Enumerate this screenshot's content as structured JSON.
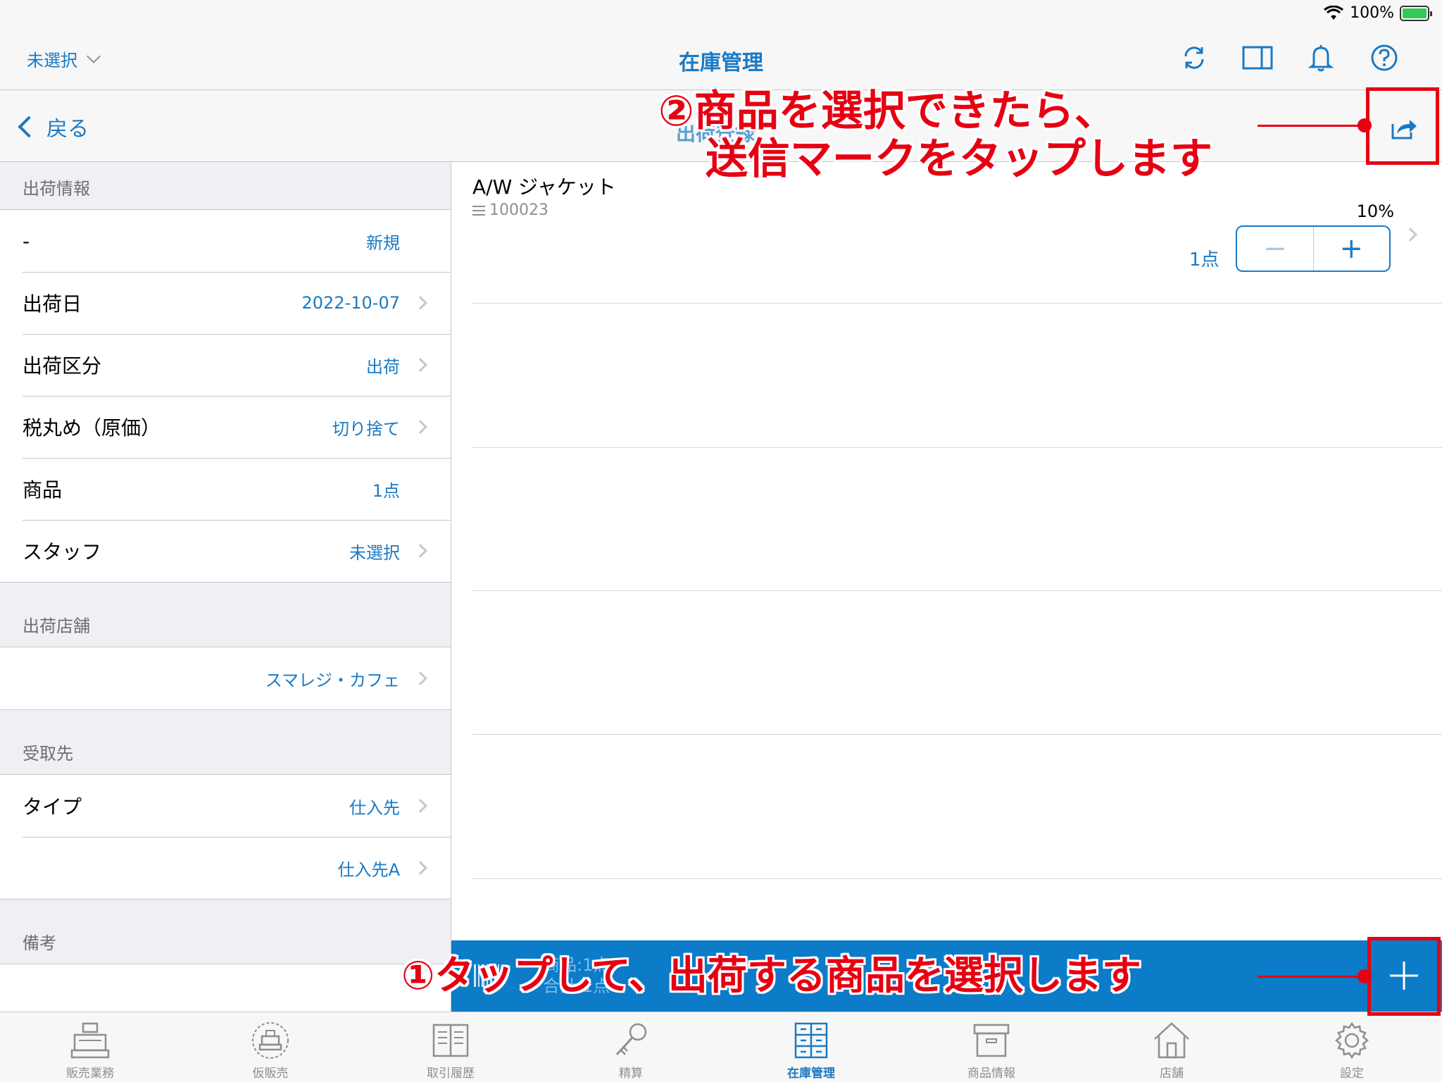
{
  "status": {
    "battery": "100%",
    "battery_level": 1.0
  },
  "nav": {
    "left_label": "未選択",
    "title": "在庫管理",
    "icons": [
      "refresh-icon",
      "split-view-icon",
      "bell-icon",
      "help-icon"
    ]
  },
  "subheader": {
    "back_label": "戻る",
    "title": "出荷登録"
  },
  "sections": {
    "shipping_info": {
      "header": "出荷情報",
      "rows": [
        {
          "label": "-",
          "value": "新規"
        },
        {
          "label": "出荷日",
          "value": "2022-10-07"
        },
        {
          "label": "出荷区分",
          "value": "出荷"
        },
        {
          "label": "税丸め（原価）",
          "value": "切り捨て"
        },
        {
          "label": "商品",
          "value": "1点"
        },
        {
          "label": "スタッフ",
          "value": "未選択"
        }
      ]
    },
    "store": {
      "header": "出荷店舗",
      "value": "スマレジ・カフェ"
    },
    "recipient": {
      "header": "受取先",
      "rows": [
        {
          "label": "タイプ",
          "value": "仕入先"
        },
        {
          "label": "",
          "value": "仕入先A"
        }
      ]
    },
    "notes": {
      "header": "備考"
    }
  },
  "product": {
    "name": "A/W ジャケット",
    "code": "100023",
    "tax": "10%",
    "qty": "1点",
    "minus": "−",
    "plus": "+"
  },
  "summary": {
    "line1": "商品:1点",
    "line2": "合計:1点"
  },
  "tabs": [
    {
      "label": "販売業務",
      "icon": "register-icon"
    },
    {
      "label": "仮販売",
      "icon": "temp-register-icon"
    },
    {
      "label": "取引履歴",
      "icon": "history-book-icon"
    },
    {
      "label": "精算",
      "icon": "key-icon"
    },
    {
      "label": "在庫管理",
      "icon": "inventory-icon",
      "active": true
    },
    {
      "label": "商品情報",
      "icon": "product-box-icon"
    },
    {
      "label": "店舗",
      "icon": "store-icon"
    },
    {
      "label": "設定",
      "icon": "settings-gear-icon"
    }
  ],
  "annotations": {
    "step2_line1": "②商品を選択できたら、",
    "step2_line2": "送信マークをタップします",
    "step1": "①タップして、出荷する商品を選択します"
  },
  "colors": {
    "accent": "#1a7ac4",
    "bar": "#0c7bc8",
    "annotation": "#e60012"
  }
}
